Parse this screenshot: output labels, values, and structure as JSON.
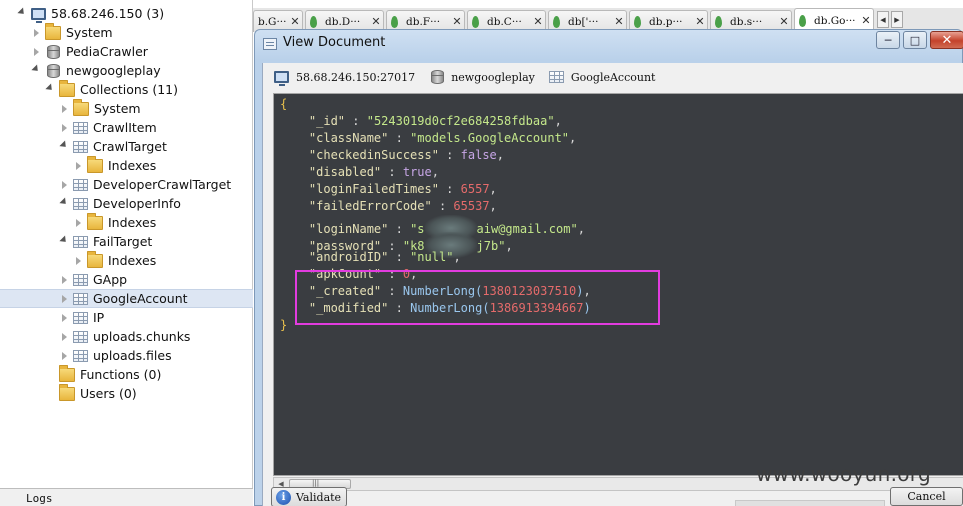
{
  "tree": {
    "items": [
      {
        "label": "58.68.246.150 (3)",
        "icon": "monitor-icon",
        "arrow": "expanded"
      },
      {
        "label": "System",
        "icon": "folder-icon",
        "arrow": "collapsed"
      },
      {
        "label": "PediaCrawler",
        "icon": "database-icon",
        "arrow": "collapsed"
      },
      {
        "label": "newgoogleplay",
        "icon": "database-icon",
        "arrow": "expanded"
      },
      {
        "label": "Collections (11)",
        "icon": "folder-icon",
        "arrow": "expanded"
      },
      {
        "label": "System",
        "icon": "folder-icon",
        "arrow": "collapsed"
      },
      {
        "label": "CrawlItem",
        "icon": "collection-icon",
        "arrow": "collapsed"
      },
      {
        "label": "CrawlTarget",
        "icon": "collection-icon",
        "arrow": "expanded"
      },
      {
        "label": "Indexes",
        "icon": "folder-icon",
        "arrow": "collapsed"
      },
      {
        "label": "DeveloperCrawlTarget",
        "icon": "collection-icon",
        "arrow": "collapsed"
      },
      {
        "label": "DeveloperInfo",
        "icon": "collection-icon",
        "arrow": "expanded"
      },
      {
        "label": "Indexes",
        "icon": "folder-icon",
        "arrow": "collapsed"
      },
      {
        "label": "FailTarget",
        "icon": "collection-icon",
        "arrow": "expanded"
      },
      {
        "label": "Indexes",
        "icon": "folder-icon",
        "arrow": "collapsed"
      },
      {
        "label": "GApp",
        "icon": "collection-icon",
        "arrow": "collapsed"
      },
      {
        "label": "GoogleAccount",
        "icon": "collection-icon",
        "arrow": "collapsed",
        "selected": true
      },
      {
        "label": "IP",
        "icon": "collection-icon",
        "arrow": "collapsed"
      },
      {
        "label": "uploads.chunks",
        "icon": "collection-icon",
        "arrow": "collapsed"
      },
      {
        "label": "uploads.files",
        "icon": "collection-icon",
        "arrow": "collapsed"
      },
      {
        "label": "Functions (0)",
        "icon": "folder-icon",
        "arrow": "none"
      },
      {
        "label": "Users (0)",
        "icon": "folder-icon",
        "arrow": "none"
      }
    ]
  },
  "logs_tab": "Logs",
  "tabs": [
    {
      "label": "b.G···"
    },
    {
      "label": "db.D···"
    },
    {
      "label": "db.F···"
    },
    {
      "label": "db.C···"
    },
    {
      "label": "db['···"
    },
    {
      "label": "db.p···"
    },
    {
      "label": "db.s···"
    },
    {
      "label": "db.Go···",
      "active": true
    }
  ],
  "dialog": {
    "title": "View Document",
    "info": {
      "server": "58.68.246.150:27017",
      "database": "newgoogleplay",
      "collection": "GoogleAccount"
    },
    "document": {
      "open": "{",
      "close": "}",
      "lines": [
        {
          "key": "\"_id\"",
          "value": "\"5243019d0cf2e684258fdbaa\"",
          "type": "str"
        },
        {
          "key": "\"className\"",
          "value": "\"models.GoogleAccount\"",
          "type": "str"
        },
        {
          "key": "\"checkedinSuccess\"",
          "value": "false",
          "type": "bool"
        },
        {
          "key": "\"disabled\"",
          "value": "true",
          "type": "bool"
        },
        {
          "key": "\"loginFailedTimes\"",
          "value": "6557",
          "type": "num"
        },
        {
          "key": "\"failedErrorCode\"",
          "value": "65537",
          "type": "num"
        },
        {
          "key": "\"loginName\"",
          "value_prefix": "\"s",
          "value_suffix": "aiw@gmail.com\"",
          "type": "str-redacted"
        },
        {
          "key": "\"password\"",
          "value_prefix": "\"k8",
          "value_suffix": "j7b\"",
          "type": "str-redacted"
        },
        {
          "key": "\"androidID\"",
          "value": "\"null\"",
          "type": "str"
        },
        {
          "key": "\"apkCount\"",
          "value": "0",
          "type": "num"
        },
        {
          "key": "\"_created\"",
          "fn": "NumberLong",
          "arg": "1380123037510",
          "type": "fn"
        },
        {
          "key": "\"_modified\"",
          "fn": "NumberLong",
          "arg": "1386913394667",
          "type": "fn",
          "last": true
        }
      ]
    },
    "validate_label": "Validate",
    "cancel_label": "Cancel",
    "scroll_grip": "|||"
  },
  "watermark": "www.wooyun.org",
  "colors": {
    "highlight": "#e23cdf",
    "editor_bg": "#3a3d41",
    "string": "#c4e88b",
    "number": "#e56b6b",
    "bool": "#c7a6e6",
    "function": "#9ac7ee"
  }
}
